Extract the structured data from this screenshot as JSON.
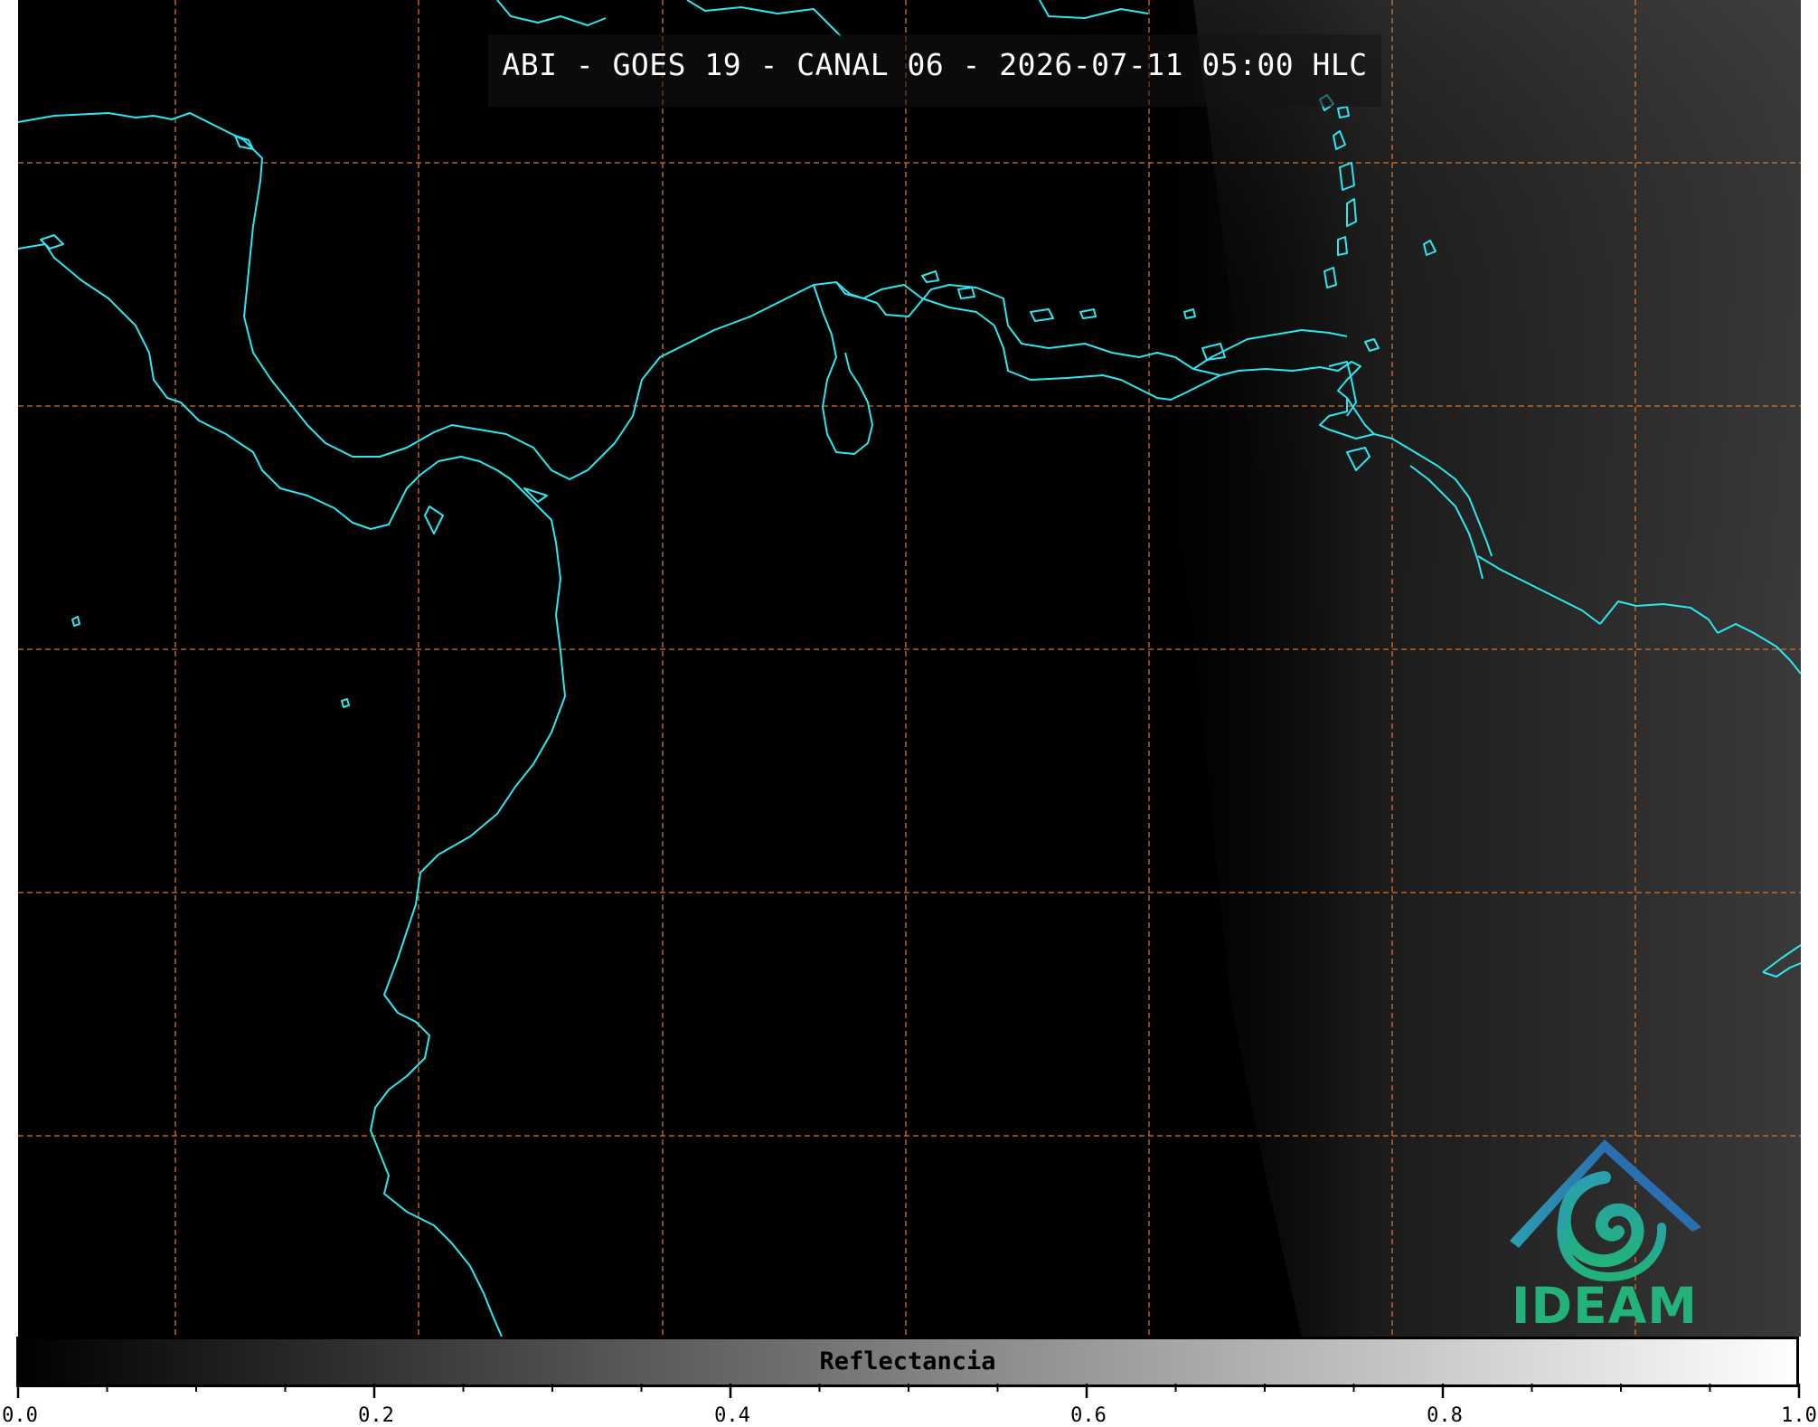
{
  "title": "ABI - GOES 19 - CANAL 06 - 2026-07-11 05:00 HLC",
  "colorbar": {
    "label": "Reflectancia",
    "ticks": [
      "0.0",
      "0.2",
      "0.4",
      "0.6",
      "0.8",
      "1.0"
    ]
  },
  "logo": {
    "text": "IDEAM"
  },
  "colors": {
    "coastline": "#2ee6f0",
    "gridline": "#d8732a",
    "background": "#000000",
    "logo_green": "#22b27a",
    "logo_blue": "#2a6fb0"
  },
  "icons": [
    "ideam-logo-icon"
  ]
}
